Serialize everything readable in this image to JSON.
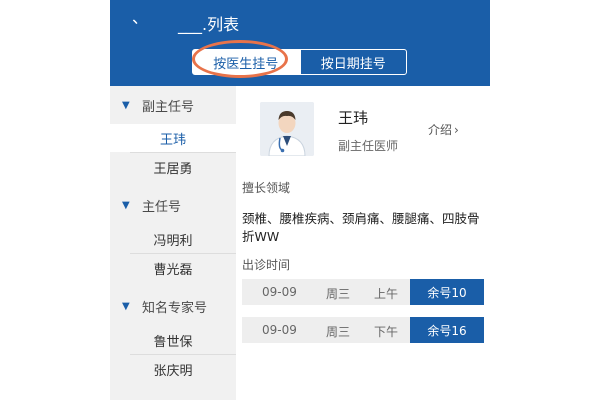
{
  "header": {
    "title_mark": "、",
    "title": "___.列表",
    "tabs": [
      {
        "label": "按医生挂号",
        "active": true
      },
      {
        "label": "按日期挂号",
        "active": false
      }
    ]
  },
  "sidebar": {
    "groups": [
      {
        "label": "副主任号",
        "doctors": [
          "王玮",
          "王居勇"
        ]
      },
      {
        "label": "主任号",
        "doctors": [
          "冯明利",
          "曹光磊"
        ]
      },
      {
        "label": "知名专家号",
        "doctors": [
          "鲁世保",
          "张庆明"
        ]
      }
    ],
    "selected_doctor": "王玮"
  },
  "detail": {
    "name": "王玮",
    "role": "副主任医师",
    "intro_label": "介绍",
    "intro_chevron": "›",
    "specialty_label": "擅长领域",
    "specialty_text": "颈椎、腰椎疾病、颈肩痛、腰腿痛、四肢骨折WW",
    "schedule_label": "出诊时间",
    "schedule": [
      {
        "date": "09-09",
        "day": "周三",
        "period": "上午",
        "availability": "余号10"
      },
      {
        "date": "09-09",
        "day": "周三",
        "period": "下午",
        "availability": "余号16"
      }
    ]
  },
  "colors": {
    "primary": "#1a5ea8",
    "highlight_oval": "#e8734a",
    "sidebar_bg": "#f1f1f1",
    "slot_bg": "#eeeeee"
  },
  "icons": {
    "avatar": "doctor-avatar-icon",
    "group_toggle": "triangle-down-icon",
    "intro": "chevron-right-icon"
  }
}
